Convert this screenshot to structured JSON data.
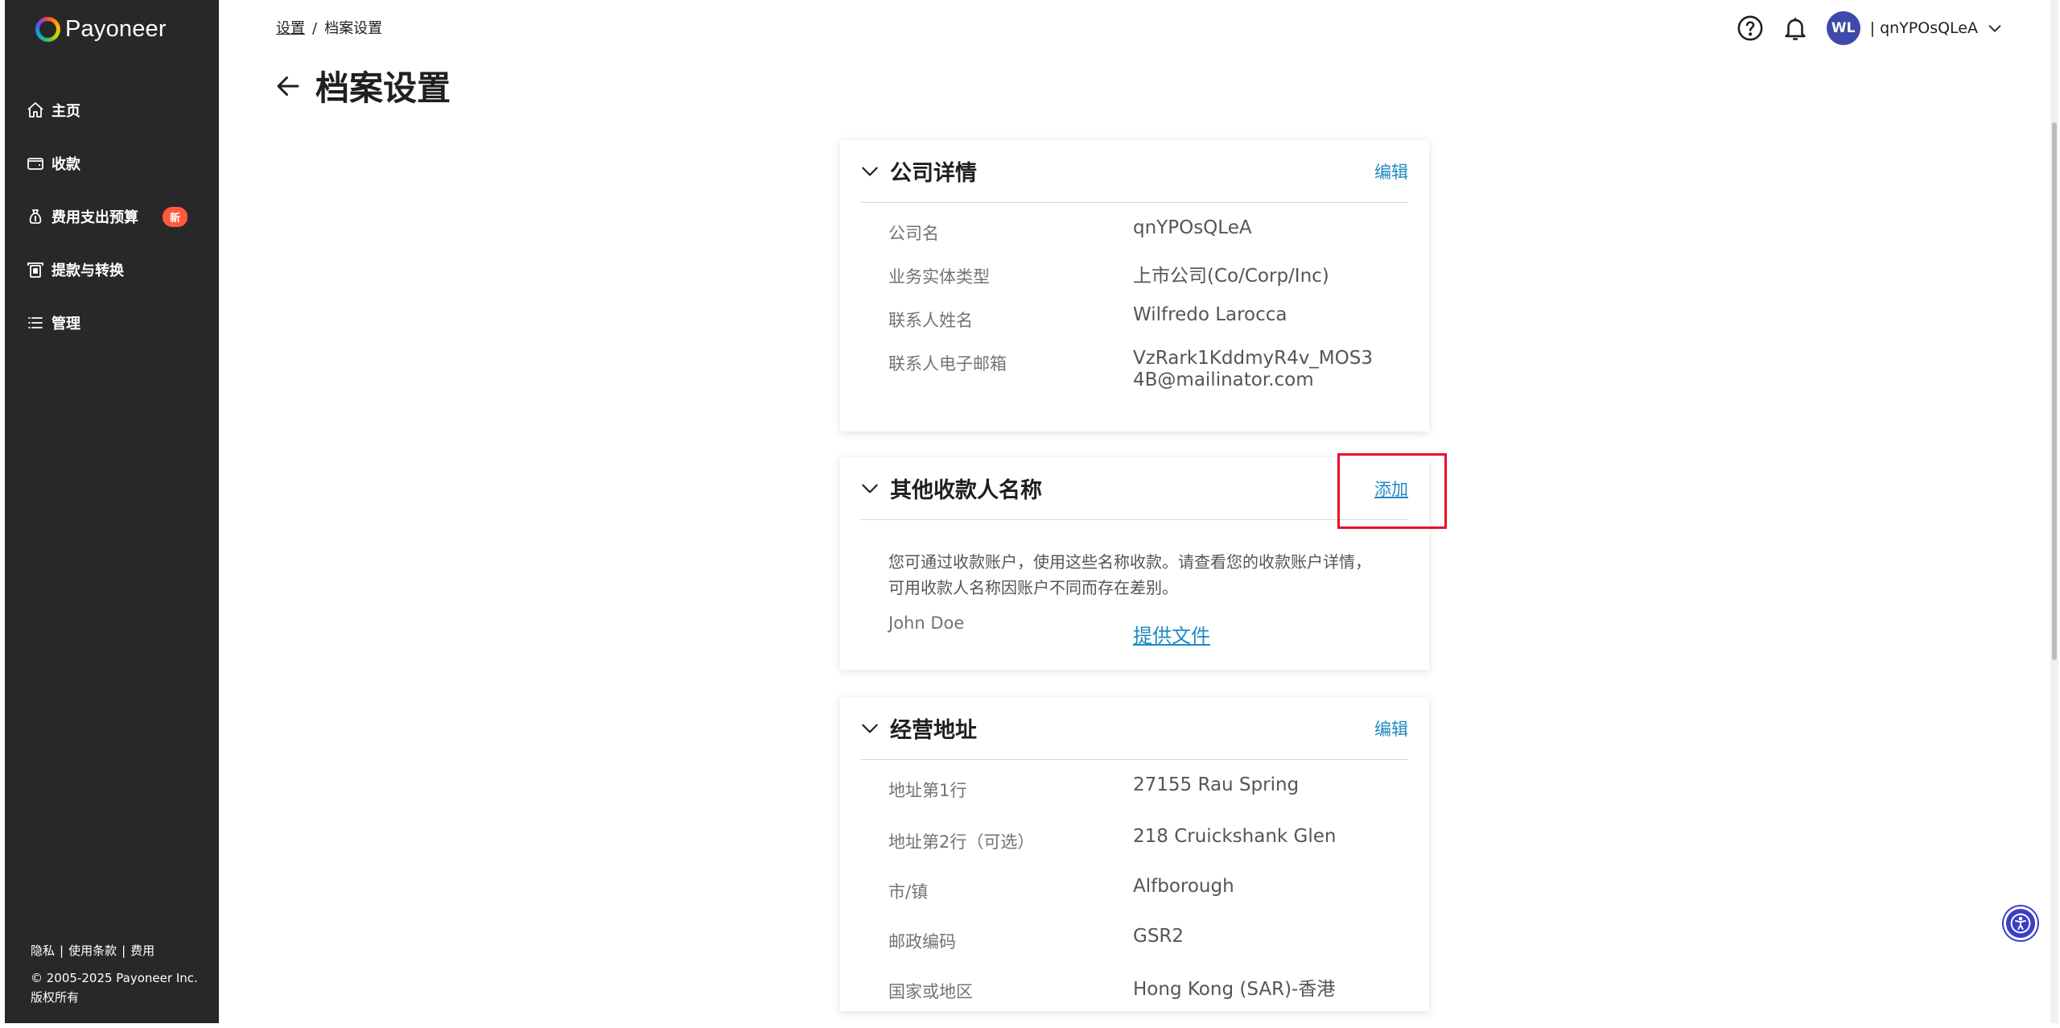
{
  "brand": {
    "name": "Payoneer"
  },
  "sidebar": {
    "items": [
      {
        "label": "主页",
        "icon": "home-icon"
      },
      {
        "label": "收款",
        "icon": "wallet-icon"
      },
      {
        "label": "费用支出预算",
        "icon": "moneybag-icon",
        "badge": "新"
      },
      {
        "label": "提款与转换",
        "icon": "withdraw-icon"
      },
      {
        "label": "管理",
        "icon": "list-icon"
      }
    ],
    "footer": {
      "privacy": "隐私",
      "terms": "使用条款",
      "fees": "费用",
      "separator": "|",
      "copyright": "© 2005-2025 Payoneer Inc.",
      "rights": "版权所有"
    }
  },
  "breadcrumb": {
    "parent": "设置",
    "separator": "/",
    "current": "档案设置"
  },
  "page": {
    "title": "档案设置"
  },
  "user": {
    "initials": "WL",
    "separator": "|",
    "name": "qnYPOsQLeA"
  },
  "company": {
    "title": "公司详情",
    "action": "编辑",
    "rows": [
      {
        "label": "公司名",
        "value": "qnYPOsQLeA"
      },
      {
        "label": "业务实体类型",
        "value": "上市公司(Co/Corp/Inc)"
      },
      {
        "label": "联系人姓名",
        "value": "Wilfredo Larocca"
      },
      {
        "label": "联系人电子邮箱",
        "value": "VzRark1KddmyR4v_MOS34B@mailinator.com"
      }
    ]
  },
  "payees": {
    "title": "其他收款人名称",
    "action": "添加",
    "description": "您可通过收款账户，使用这些名称收款。请查看您的收款账户详情，可用收款人名称因账户不同而存在差别。",
    "rows": [
      {
        "name": "John Doe",
        "link": "提供文件"
      }
    ]
  },
  "address": {
    "title": "经营地址",
    "action": "编辑",
    "rows": [
      {
        "label": "地址第1行",
        "value": "27155 Rau Spring"
      },
      {
        "label": "地址第2行（可选）",
        "value": "218 Cruickshank Glen"
      },
      {
        "label": "市/镇",
        "value": "Alfborough"
      },
      {
        "label": "邮政编码",
        "value": "GSR2"
      },
      {
        "label": "国家或地区",
        "value": "Hong Kong (SAR)-香港"
      }
    ]
  },
  "colors": {
    "sidebar": "#282828",
    "link": "#1f8ac0",
    "badge": "#ff5a3d",
    "avatar": "#3d4aa8",
    "highlight": "#e8102a"
  }
}
